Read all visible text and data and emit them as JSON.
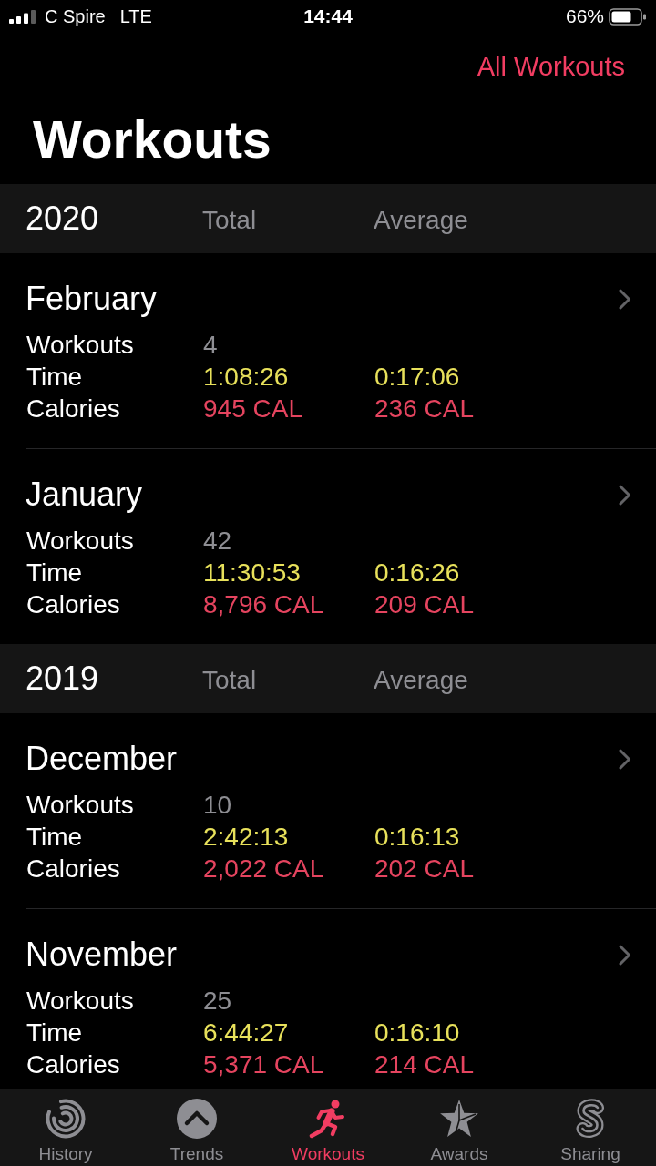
{
  "status_bar": {
    "carrier": "C Spire",
    "network": "LTE",
    "time": "14:44",
    "battery": "66%"
  },
  "header": {
    "action": "All Workouts",
    "title": "Workouts"
  },
  "sections": [
    {
      "year": "2020",
      "column_1": "Total",
      "column_2": "Average",
      "months": [
        {
          "name": "February",
          "stats": [
            {
              "kind": "count",
              "label": "Workouts",
              "total": "4"
            },
            {
              "kind": "time",
              "label": "Time",
              "total": "1:08:26",
              "average": "0:17:06"
            },
            {
              "kind": "calories",
              "label": "Calories",
              "total": "945 CAL",
              "average": "236 CAL"
            }
          ]
        },
        {
          "name": "January",
          "stats": [
            {
              "kind": "count",
              "label": "Workouts",
              "total": "42"
            },
            {
              "kind": "time",
              "label": "Time",
              "total": "11:30:53",
              "average": "0:16:26"
            },
            {
              "kind": "calories",
              "label": "Calories",
              "total": "8,796 CAL",
              "average": "209 CAL"
            }
          ]
        }
      ]
    },
    {
      "year": "2019",
      "column_1": "Total",
      "column_2": "Average",
      "months": [
        {
          "name": "December",
          "stats": [
            {
              "kind": "count",
              "label": "Workouts",
              "total": "10"
            },
            {
              "kind": "time",
              "label": "Time",
              "total": "2:42:13",
              "average": "0:16:13"
            },
            {
              "kind": "calories",
              "label": "Calories",
              "total": "2,022 CAL",
              "average": "202 CAL"
            }
          ]
        },
        {
          "name": "November",
          "stats": [
            {
              "kind": "count",
              "label": "Workouts",
              "total": "25"
            },
            {
              "kind": "time",
              "label": "Time",
              "total": "6:44:27",
              "average": "0:16:10"
            },
            {
              "kind": "calories",
              "label": "Calories",
              "total": "5,371 CAL",
              "average": "214 CAL"
            }
          ]
        }
      ]
    }
  ],
  "tab_bar": {
    "tabs": [
      {
        "label": "History",
        "selected": false
      },
      {
        "label": "Trends",
        "selected": false
      },
      {
        "label": "Workouts",
        "selected": true
      },
      {
        "label": "Awards",
        "selected": false
      },
      {
        "label": "Sharing",
        "selected": false
      }
    ]
  }
}
